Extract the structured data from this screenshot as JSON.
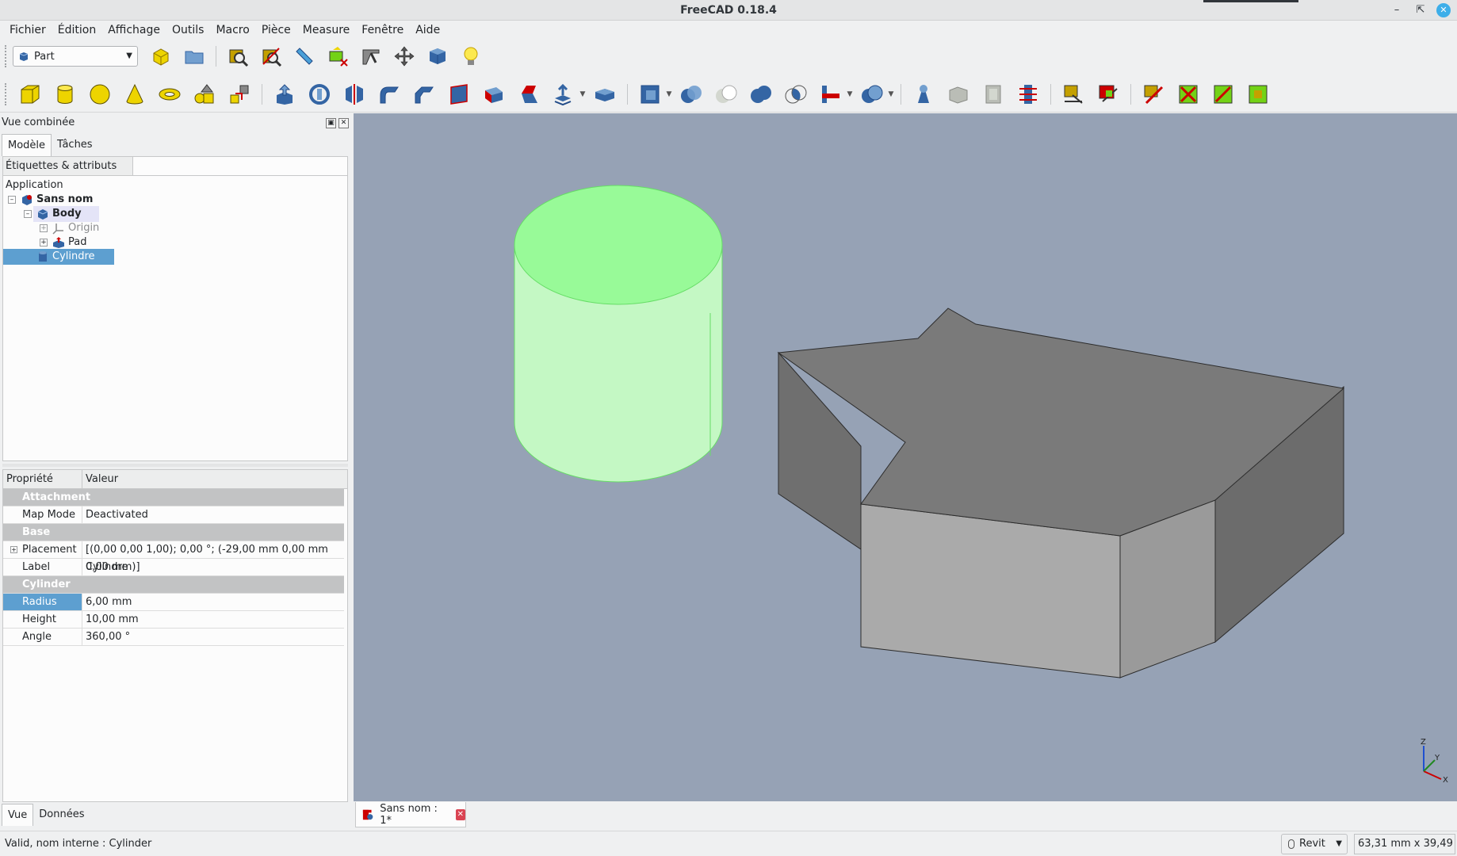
{
  "window": {
    "title": "FreeCAD 0.18.4"
  },
  "menu": [
    "Fichier",
    "Édition",
    "Affichage",
    "Outils",
    "Macro",
    "Pièce",
    "Measure",
    "Fenêtre",
    "Aide"
  ],
  "workbench": {
    "selected": "Part"
  },
  "combo": {
    "title": "Vue combinée",
    "tabs": [
      "Modèle",
      "Tâches"
    ],
    "tree_header": "Étiquettes & attributs",
    "tree": {
      "root": "Application",
      "document": "Sans nom",
      "body": "Body",
      "origin": "Origin",
      "pad": "Pad",
      "cylinder": "Cylindre"
    },
    "properties": {
      "col_property": "Propriété",
      "col_value": "Valeur",
      "group_attachment": "Attachment",
      "map_mode_label": "Map Mode",
      "map_mode_value": "Deactivated",
      "group_base": "Base",
      "placement_label": "Placement",
      "placement_value": "[(0,00 0,00 1,00); 0,00 °; (-29,00 mm  0,00 mm  0,00 mm)]",
      "label_label": "Label",
      "label_value": "Cylindre",
      "group_cylinder": "Cylinder",
      "radius_label": "Radius",
      "radius_value": "6,00 mm",
      "height_label": "Height",
      "height_value": "10,00 mm",
      "angle_label": "Angle",
      "angle_value": "360,00 °"
    },
    "bottom_tabs": [
      "Vue",
      "Données"
    ]
  },
  "document_tab": {
    "label": "Sans nom : 1*"
  },
  "status": {
    "message": "Valid, nom interne : Cylinder",
    "navigation_style": "Revit",
    "dimensions": "63,31 mm x 39,49 mm"
  },
  "axis": {
    "x": "X",
    "y": "Y",
    "z": "Z"
  },
  "colors": {
    "viewport_bg": "#96a2b5",
    "cylinder_top": "#98fa98",
    "cylinder_side": "#c4f8c4",
    "selection_blue": "#5d9fd0"
  }
}
